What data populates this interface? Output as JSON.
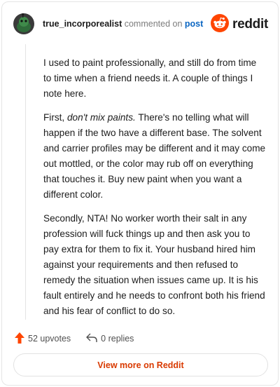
{
  "header": {
    "username": "true_incorporealist",
    "commented_text": "commented on",
    "post_link": "post",
    "brand": "reddit"
  },
  "comment": {
    "paragraphs": [
      "I used to paint professionally, and still do from time to time when a friend needs it. A couple of things I note here.",
      {
        "before": "First, ",
        "emphasis": "don't mix paints.",
        "after": " There's no telling what will happen if the two have a different base. The solvent and carrier profiles may be different and it may come out mottled, or the color may rub off on everything that touches it. Buy new paint when you want a different color."
      },
      "Secondly, NTA! No worker worth their salt in any profession will fuck things up and then ask you to pay extra for them to fix it. Your husband hired him against your requirements and then refused to remedy the situation when issues came up. It is his fault entirely and he needs to confront both his friend and his fear of conflict to do so."
    ]
  },
  "actions": {
    "upvotes": "52 upvotes",
    "replies": "0 replies"
  },
  "footer": {
    "view_more": "View more on Reddit"
  },
  "colors": {
    "brand_orange": "#ff4500",
    "link_blue": "#0b66c2",
    "view_more_text": "#d93a00"
  },
  "icons": [
    "avatar",
    "reddit-logo-icon",
    "upvote-arrow-icon",
    "reply-icon"
  ]
}
